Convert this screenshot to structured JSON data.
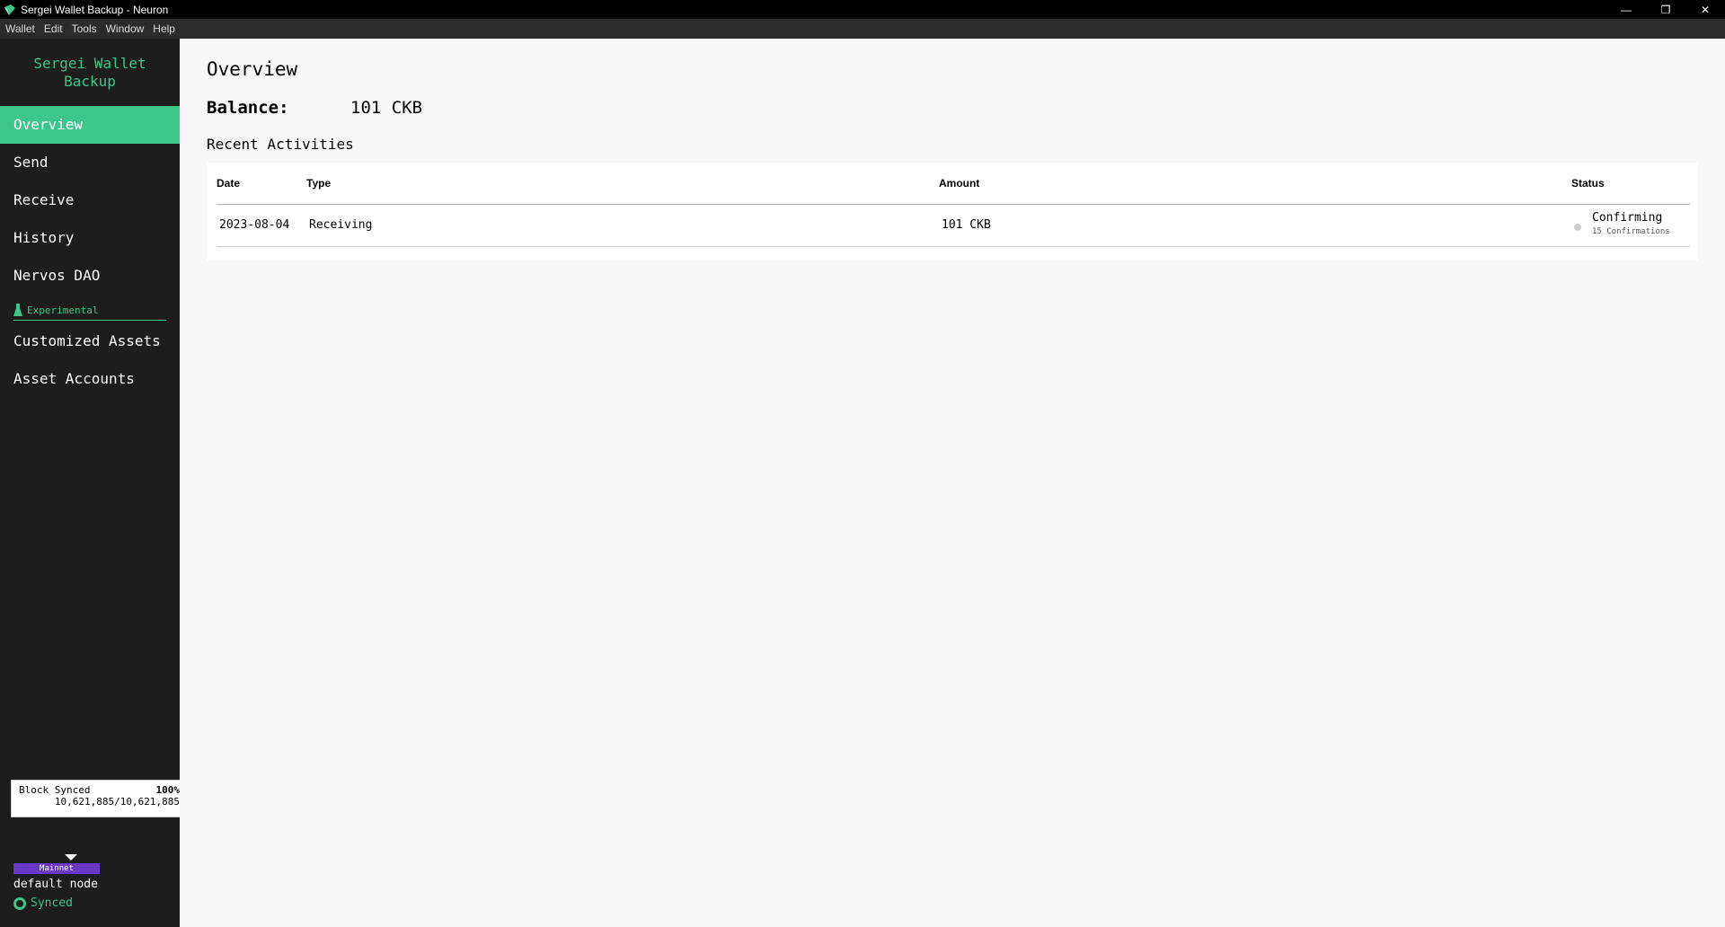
{
  "window": {
    "title": "Sergei Wallet Backup - Neuron",
    "minimize_glyph": "—",
    "restore_glyph": "❐",
    "close_glyph": "✕"
  },
  "menubar": [
    "Wallet",
    "Edit",
    "Tools",
    "Window",
    "Help"
  ],
  "sidebar": {
    "wallet_name": "Sergei Wallet Backup",
    "items": [
      {
        "label": "Overview",
        "active": true
      },
      {
        "label": "Send"
      },
      {
        "label": "Receive"
      },
      {
        "label": "History"
      },
      {
        "label": "Nervos DAO"
      }
    ],
    "experimental_label": "Experimental",
    "experimental_items": [
      {
        "label": "Customized Assets"
      },
      {
        "label": "Asset Accounts"
      }
    ],
    "sync": {
      "label": "Block Synced",
      "percent": "100%",
      "blocks": "10,621,885/10,621,885",
      "network_badge": "Mainnet",
      "node": "default node",
      "status": "Synced"
    }
  },
  "main": {
    "title": "Overview",
    "balance_label": "Balance:",
    "balance_value": "101 CKB",
    "recent_title": "Recent Activities",
    "table": {
      "headers": {
        "date": "Date",
        "type": "Type",
        "amount": "Amount",
        "status": "Status"
      },
      "rows": [
        {
          "date": "2023-08-04",
          "type": "Receiving",
          "amount": "101 CKB",
          "status": "Confirming",
          "confirmations": "15 Confirmations"
        }
      ]
    }
  },
  "colors": {
    "accent": "#3cc68a",
    "sidebar_bg": "#1d1d1d",
    "mainnet_badge": "#6a38c7"
  }
}
